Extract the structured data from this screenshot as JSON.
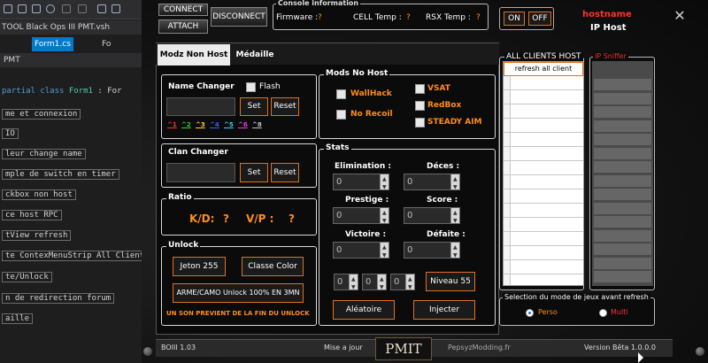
{
  "vs": {
    "title": "TOOL Black Ops III PMT.vsh",
    "tabs": [
      "Form1.cs",
      "Fo"
    ],
    "breadcrumb": "PMT",
    "code_lines": [
      "partial class Form1 : For",
      "me et connexion",
      "IO",
      "leur change name",
      "mple de switch en timer",
      "ckbox non host",
      "ce host RPC",
      "tView refresh",
      "te ContexMenuStrip All Client",
      "te/Unlock",
      "n de redirection forum",
      "aille"
    ]
  },
  "header": {
    "connect": "CONNECT",
    "attach": "ATTACH",
    "disconnect": "DISCONNECT",
    "console_info_label": "Console information",
    "firmware_label": "Firmware :",
    "firmware_value": "?",
    "cell_temp_label": "CELL Temp :",
    "cell_temp_value": "?",
    "rsx_temp_label": "RSX Temp :",
    "rsx_temp_value": "?",
    "on": "ON",
    "off": "OFF",
    "hostname": "hostname",
    "ip_host": "IP Host",
    "close": "✕"
  },
  "tabs": {
    "modz_non_host": "Modz Non Host",
    "medaille": "Médaille"
  },
  "name_changer": {
    "title": "Name Changer",
    "flash": "Flash",
    "set": "Set",
    "reset": "Reset",
    "colors": [
      {
        "label": "^1",
        "color": "#ff3030"
      },
      {
        "label": "^2",
        "color": "#30d030"
      },
      {
        "label": "^3",
        "color": "#ffd020"
      },
      {
        "label": "^4",
        "color": "#3060ff"
      },
      {
        "label": "^5",
        "color": "#30d0ff"
      },
      {
        "label": "^6",
        "color": "#e040e0"
      },
      {
        "label": "^8",
        "color": "#c0c0c0"
      }
    ]
  },
  "clan_changer": {
    "title": "Clan Changer",
    "set": "Set",
    "reset": "Reset"
  },
  "ratio": {
    "title": "Ratio",
    "kd": "K/D:",
    "kd_value": "?",
    "vp": "V/P :",
    "vp_value": "?"
  },
  "unlock": {
    "title": "Unlock",
    "jeton": "Jeton 255",
    "classe_color": "Classe Color",
    "arme_camo": "ARME/CAMO Unlock 100% EN 3MN",
    "warning": "UN SON PREVIENT DE LA FIN DU UNLOCK"
  },
  "mods_no_host": {
    "title": "Mods No Host",
    "wallhack": "WallHack",
    "no_recoil": "No Recoil",
    "vsat": "VSAT",
    "redbox": "RedBox",
    "steady_aim": "STEADY AIM"
  },
  "stats": {
    "title": "Stats",
    "elimination": "Elimination :",
    "deces": "Déces :",
    "prestige": "Prestige :",
    "score": "Score :",
    "victoire": "Victoire :",
    "defaite": "Défaite :",
    "elimination_value": "0",
    "deces_value": "0",
    "prestige_value": "0",
    "score_value": "0",
    "victoire_value": "0",
    "defaite_value": "0",
    "niveau_values": [
      "0",
      "0",
      "0"
    ],
    "niveau_button": "Niveau 55",
    "aleatoire": "Aléatoire",
    "injecter": "Injecter"
  },
  "clients": {
    "title": "ALL CLIENTS HOST",
    "refresh": "refresh all client"
  },
  "ip_sniffer": {
    "title": "IP Sniffer"
  },
  "game_mode": {
    "title": "Selection du mode de jeux avant refresh",
    "perso": "Perso",
    "multi": "Multi"
  },
  "footer": {
    "version_game": "BOIII 1.03",
    "update": "Mise a jour",
    "logo": "PMIT",
    "site": "PepsyzModding.fr",
    "version_tool": "Version Bêta 1.0.0.0"
  },
  "colors": {
    "accent_orange": "#ff8c1a",
    "button_border": "#e07020",
    "sniffer_red": "#e83030",
    "hostname_red": "#ff3030"
  }
}
